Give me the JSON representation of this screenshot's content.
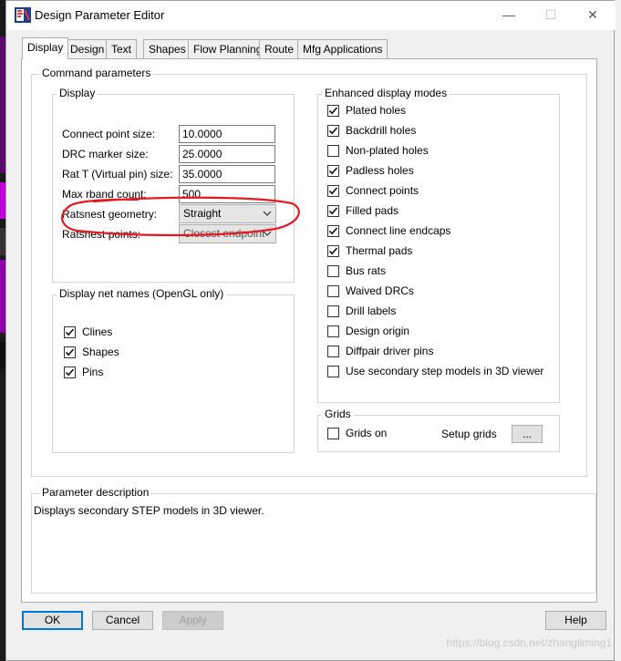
{
  "window": {
    "title": "Design Parameter Editor",
    "minimize_glyph": "—",
    "maximize_glyph": "☐",
    "close_glyph": "✕"
  },
  "tabs": [
    {
      "label": "Display",
      "active": true
    },
    {
      "label": "Design"
    },
    {
      "label": "Text"
    },
    {
      "label": "Shapes"
    },
    {
      "label": "Flow Planning"
    },
    {
      "label": "Route"
    },
    {
      "label": "Mfg Applications"
    }
  ],
  "command_parameters": {
    "title": "Command parameters",
    "display": {
      "title": "Display",
      "fields": [
        {
          "label": "Connect point size:",
          "value": "10.0000"
        },
        {
          "label": "DRC marker size:",
          "value": "25.0000"
        },
        {
          "label": "Rat T (Virtual pin) size:",
          "value": "35.0000"
        },
        {
          "label": "Max rband count:",
          "value": "500"
        }
      ],
      "ratsnest_geometry": {
        "label": "Ratsnest geometry:",
        "value": "Straight"
      },
      "ratsnest_points": {
        "label": "Ratsnest points:",
        "value": "Closest endpoint"
      }
    },
    "net_names": {
      "title": "Display net names (OpenGL only)",
      "items": [
        {
          "label": "Clines",
          "checked": true
        },
        {
          "label": "Shapes",
          "checked": true
        },
        {
          "label": "Pins",
          "checked": true
        }
      ]
    },
    "enhanced": {
      "title": "Enhanced display modes",
      "items": [
        {
          "label": "Plated holes",
          "checked": true
        },
        {
          "label": "Backdrill holes",
          "checked": true
        },
        {
          "label": "Non-plated holes",
          "checked": false
        },
        {
          "label": "Padless holes",
          "checked": true
        },
        {
          "label": "Connect points",
          "checked": true
        },
        {
          "label": "Filled pads",
          "checked": true
        },
        {
          "label": "Connect line endcaps",
          "checked": true
        },
        {
          "label": "Thermal pads",
          "checked": true
        },
        {
          "label": "Bus rats",
          "checked": false
        },
        {
          "label": "Waived DRCs",
          "checked": false
        },
        {
          "label": "Drill labels",
          "checked": false
        },
        {
          "label": "Design origin",
          "checked": false
        },
        {
          "label": "Diffpair driver pins",
          "checked": false
        },
        {
          "label": "Use secondary step models in 3D viewer",
          "checked": false
        }
      ]
    },
    "grids": {
      "title": "Grids",
      "grids_on": {
        "label": "Grids on",
        "checked": false
      },
      "setup_label": "Setup grids",
      "setup_button": "..."
    }
  },
  "parameter_description": {
    "title": "Parameter description",
    "text": "Displays secondary STEP models in 3D viewer."
  },
  "buttons": {
    "ok": "OK",
    "cancel": "Cancel",
    "apply": "Apply",
    "help": "Help"
  },
  "watermark": "https://blog.csdn.net/zhangliming1",
  "colors": {
    "annotation_circle": "#e8191e",
    "focus_border": "#0078d7",
    "background_app_accent": "#b000c8"
  },
  "icons": {
    "app": "allegro-app-icon",
    "check": "checkmark-icon",
    "dropdown": "chevron-down-icon"
  }
}
